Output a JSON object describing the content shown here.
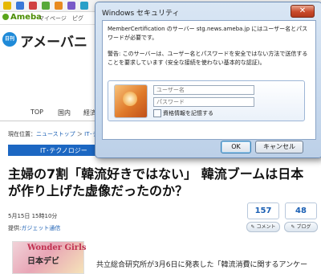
{
  "browser": {
    "ameba_bar": {
      "logo": "Ameba",
      "links": [
        "マイページ",
        "ピグ"
      ]
    }
  },
  "site": {
    "logo_badge": "日刊",
    "logo_text": "アメーバニ",
    "nav": {
      "items": [
        "TOP",
        "国内",
        "経済"
      ]
    },
    "breadcrumb": {
      "prefix": "現在位置：",
      "link": "ニューストップ",
      "separator": "＞",
      "tail": "IT･テ"
    },
    "category": "IT･テクノロジー",
    "article": {
      "headline_line1": "主婦の7割「韓流好きではない」 韓流ブームは日本",
      "headline_line2": "が作り上げた虚像だったのか？",
      "date": "5月15日 15時10分",
      "provider_label": "提供:",
      "provider_link": "ガジェット通信",
      "comment_count": "157",
      "blog_count": "48",
      "comment_button": "コメント",
      "blog_button": "ブログ",
      "thumb_title": "Wonder Girls",
      "thumb_sub": "日本デビ",
      "body_start": "共立総合研究所が3月6日に発表した「韓流消費に関するアンケー"
    }
  },
  "dialog": {
    "title": "Windows セキュリティ",
    "close_label": "✕",
    "message1": "MemberCertification のサーバー stg.news.ameba.jp にはユーザー名とパスワードが必要です。",
    "message2": "警告: このサーバーは、ユーザー名とパスワードを安全ではない方法で送信することを要求しています (安全な接続を使わない基本的な認証)。",
    "username_placeholder": "ユーザー名",
    "password_placeholder": "パスワード",
    "remember_label": "資格情報を記憶する",
    "ok_label": "OK",
    "cancel_label": "キャンセル"
  }
}
